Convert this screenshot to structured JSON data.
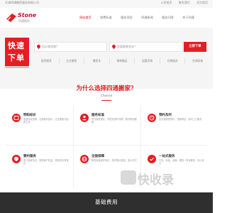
{
  "topbar": {
    "company": "天津四通搬家服务有限公司",
    "links": [
      "公司首页",
      "联系我们",
      "设为首页"
    ]
  },
  "brand": {
    "name": "Stone",
    "tagline": "四通搬家"
  },
  "nav": {
    "items": [
      "网站首页",
      "收费标准",
      "服务项目",
      "四通新闻",
      "服务问答",
      "关于四通"
    ],
    "active_index": 0
  },
  "hero": {
    "badge_line1": "快速",
    "badge_line2": "下单",
    "from_placeholder": "您从哪里搬?",
    "to_placeholder": "您要搬哪里去?",
    "submit_label": "立即下单"
  },
  "quick_links": [
    "居民搬家",
    "企业搬家",
    "搬家车",
    "钢琴搬运",
    "起重吊装",
    "仓储服务",
    "空调拆装"
  ],
  "why": {
    "title": "为什么选择四通搬家？",
    "subtitle": "Choose"
  },
  "features": [
    {
      "icon": "price-tag-icon",
      "title": "明码标价",
      "desc": "收费标准透明，杜绝临时加价，让您搬家无后顾之忧"
    },
    {
      "icon": "team-icon",
      "title": "服务标准",
      "desc": "专业搬家团队，规范化操作流程，服务周到细致"
    },
    {
      "icon": "clock-icon",
      "title": "预约及时",
      "desc": "全天候接受预约，快速响应，准时上门服务"
    },
    {
      "icon": "shield-icon",
      "title": "要约服务",
      "desc": "签订搬家协议，保障客户权益，物品安全有保证"
    },
    {
      "icon": "globe-icon",
      "title": "全面保障",
      "desc": "物品包装保护到位，损坏照价赔偿，放心托付"
    },
    {
      "icon": "check-icon",
      "title": "一站式服务",
      "desc": "打包、拆装、运输、摆放一条龙服务，省心省力"
    }
  ],
  "watermark": {
    "text": "快收录"
  },
  "footer_band": {
    "title": "基础费用"
  },
  "colors": {
    "accent": "#e31e24",
    "footer_bg": "#2f2f2f"
  }
}
